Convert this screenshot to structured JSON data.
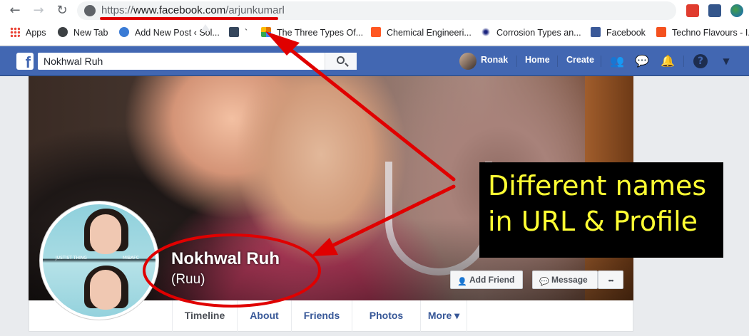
{
  "browser": {
    "url_protocol": "https://",
    "url_host": "www.facebook.com",
    "url_path": "/arjunkumarl",
    "bookmarks": [
      {
        "label": "Apps",
        "icon": "apps-grid-icon",
        "color": "#ea4335"
      },
      {
        "label": "New Tab",
        "icon": "globe-icon",
        "color": "#5f6368"
      },
      {
        "label": "Add New Post ‹ Sol...",
        "icon": "s-logo-icon",
        "color": "#3a7bd5"
      },
      {
        "label": "`",
        "icon": "tumblr-icon",
        "color": "#35465c"
      },
      {
        "label": "The Three Types Of...",
        "icon": "pinwheel-icon",
        "color": "#e37400"
      },
      {
        "label": "Chemical Engineeri...",
        "icon": "blogger-icon",
        "color": "#ff5722"
      },
      {
        "label": "Corrosion Types an...",
        "icon": "star-burst-icon",
        "color": "#1a237e"
      },
      {
        "label": "Facebook",
        "icon": "facebook-icon",
        "color": "#3b5998"
      },
      {
        "label": "Techno Flavours - I...",
        "icon": "tf-logo-icon",
        "color": "#f4511e"
      }
    ]
  },
  "fb": {
    "search_value": "Nokhwal Ruh",
    "user": "Ronak",
    "home": "Home",
    "create": "Create",
    "brand_color": "#4267b2"
  },
  "profile": {
    "name": "Nokhwal Ruh",
    "alt_name": "(Ruu)",
    "add_friend": "Add Friend",
    "message": "Message",
    "more_dots": "•••",
    "pic_caption_left": "JUSTIST THING",
    "pic_caption_right": "MIBAFC"
  },
  "tabs": [
    {
      "label": "Timeline"
    },
    {
      "label": "About"
    },
    {
      "label": "Friends"
    },
    {
      "label": "Photos"
    },
    {
      "label": "More ▾"
    }
  ],
  "annotation": {
    "line1": "Different names",
    "line2": "in URL & Profile",
    "color": "#ffff33"
  }
}
